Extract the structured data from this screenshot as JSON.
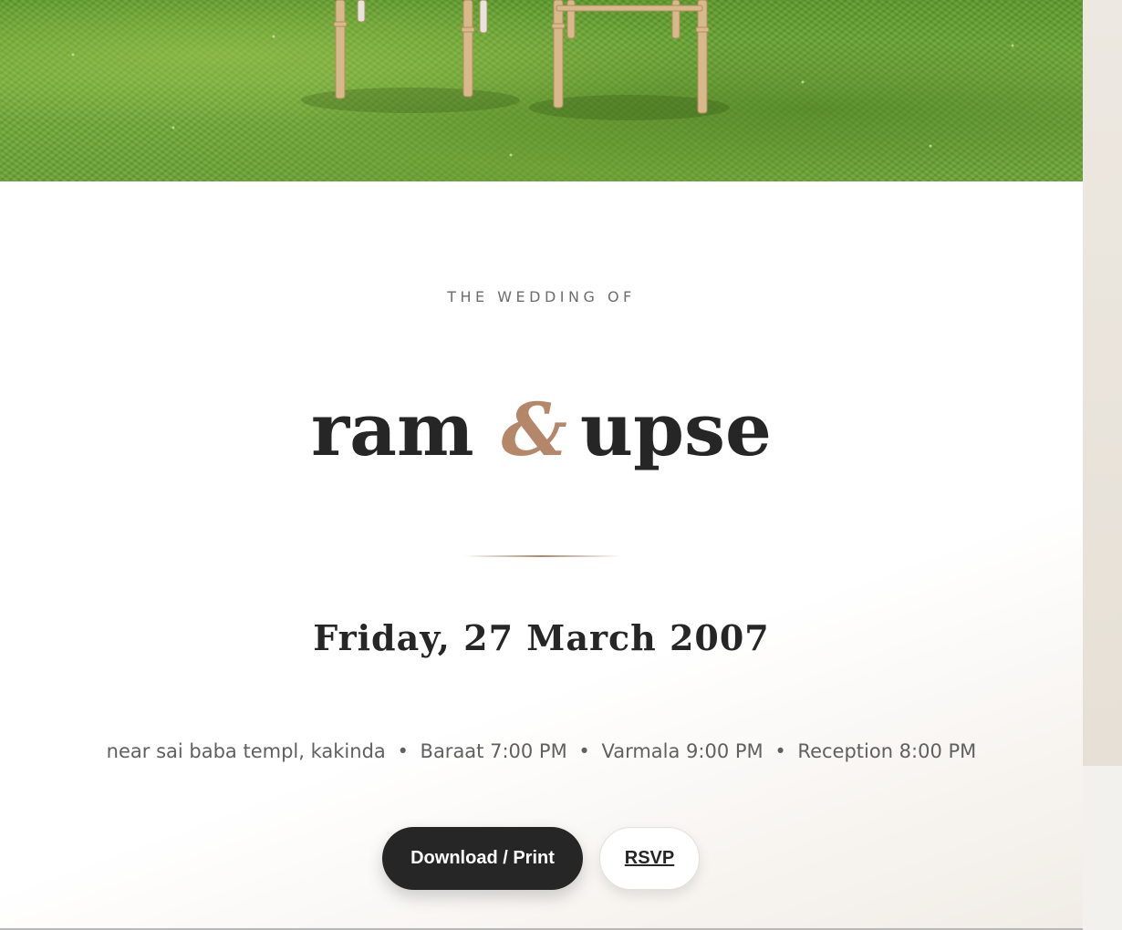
{
  "hero": {
    "image": "grass-with-wooden-chairs"
  },
  "invitation": {
    "eyebrow": "THE WEDDING OF",
    "groom": "ram",
    "ampersand": "&",
    "bride": "upse",
    "date": "Friday, 27 March 2007",
    "venue": "near sai baba templ, kakinda",
    "events": [
      "Baraat 7:00 PM",
      "Varmala 9:00 PM",
      "Reception 8:00 PM"
    ],
    "separator": "•"
  },
  "actions": {
    "download_label": "Download / Print",
    "rsvp_label": "RSVP"
  },
  "colors": {
    "accent": "#b5876a",
    "text_dark": "#262626",
    "text_muted": "#606060",
    "gutter": "#e6e0d6"
  }
}
